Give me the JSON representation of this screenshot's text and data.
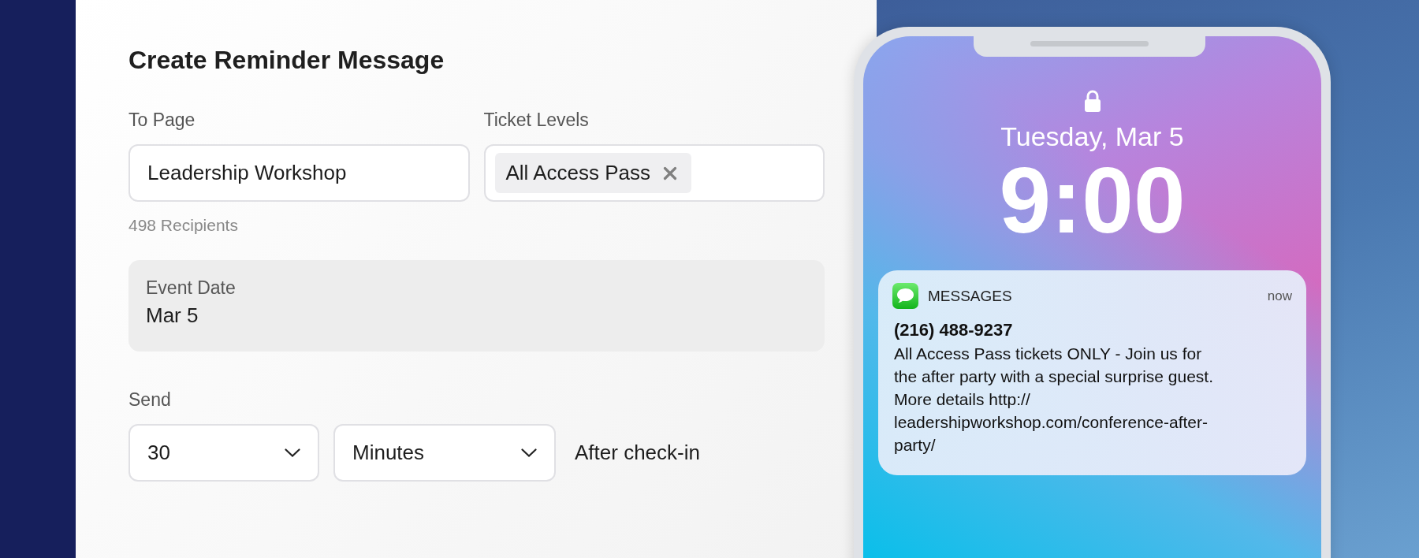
{
  "form": {
    "title": "Create Reminder Message",
    "to_page": {
      "label": "To Page",
      "value": "Leadership Workshop"
    },
    "ticket_levels": {
      "label": "Ticket Levels",
      "tags": [
        {
          "label": "All Access Pass"
        }
      ]
    },
    "recipients": "498 Recipients",
    "event_date": {
      "label": "Event Date",
      "value": "Mar 5"
    },
    "send": {
      "label": "Send",
      "amount": "30",
      "unit": "Minutes",
      "suffix": "After check-in"
    }
  },
  "phone": {
    "date": "Tuesday, Mar 5",
    "time": "9:00",
    "notification": {
      "app": "MESSAGES",
      "time": "now",
      "sender": "(216) 488-9237",
      "body": "All Access Pass tickets ONLY - Join us for the after party with a special surprise guest. More details http:// leadershipworkshop.com/conference-after-party/"
    }
  }
}
